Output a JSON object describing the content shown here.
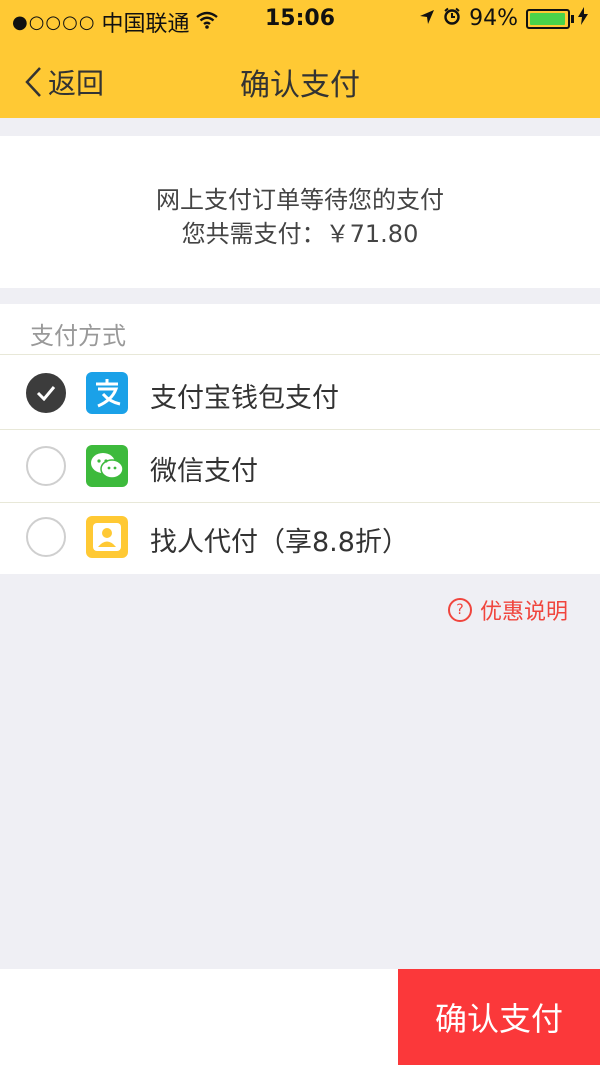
{
  "status_bar": {
    "signal": "●○○○○",
    "carrier": "中国联通",
    "time": "15:06",
    "battery": "94%",
    "battery_level": 0.94
  },
  "nav": {
    "back_label": "返回",
    "title": "确认支付"
  },
  "summary": {
    "line1": "网上支付订单等待您的支付",
    "line2": "您共需支付：￥71.80"
  },
  "methods": {
    "title": "支付方式",
    "items": [
      {
        "label": "支付宝钱包支付",
        "checked": true,
        "icon": "alipay-icon",
        "color": "#1aa1e8"
      },
      {
        "label": "微信支付",
        "checked": false,
        "icon": "wechat-icon",
        "color": "#3dba3c"
      },
      {
        "label": "找人代付（享8.8折）",
        "checked": false,
        "icon": "friend-pay-icon",
        "color": "#ffc934"
      }
    ]
  },
  "discount": {
    "label": "优惠说明"
  },
  "footer": {
    "confirm_label": "确认支付",
    "confirm_color": "#fb383a"
  },
  "colors": {
    "brand": "#ffc934",
    "accent_red": "#f0453d"
  }
}
